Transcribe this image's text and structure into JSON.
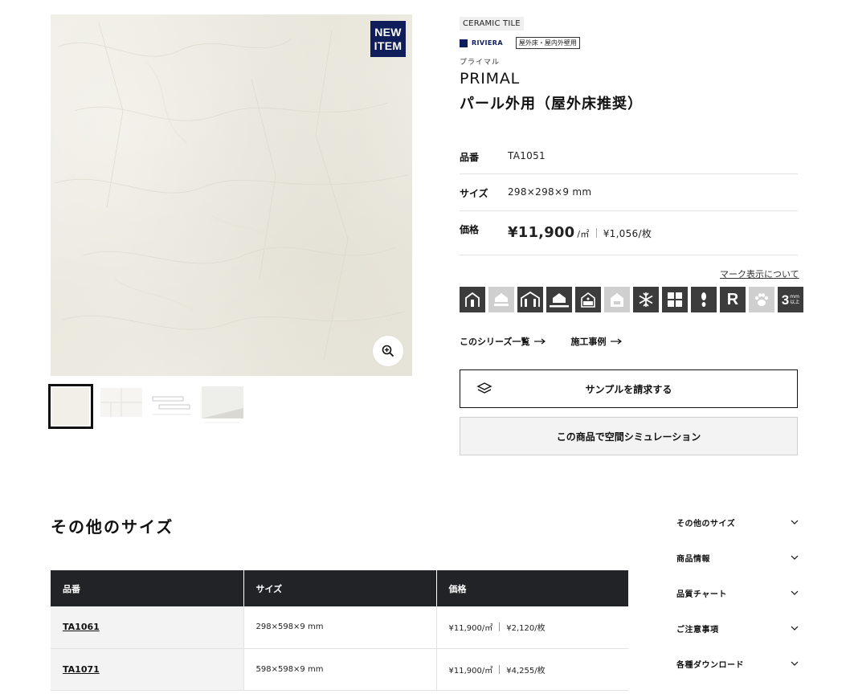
{
  "product": {
    "badge_line1": "NEW",
    "badge_line2": "ITEM",
    "category": "CERAMIC TILE",
    "brand": "RIVIERA",
    "brand_color": "#0f1d5a",
    "usage": "屋外床・屋内外壁用",
    "name_kana": "プライマル",
    "name_en": "PRIMAL",
    "name_jp": "パール外用（屋外床推奨）"
  },
  "specs": {
    "code_label": "品番",
    "code_value": "TA1051",
    "size_label": "サイズ",
    "size_value": "298×298×9 mm",
    "price_label": "価格",
    "price_main": "¥11,900",
    "price_unit": "/㎡",
    "price_sub": "¥1,056/枚"
  },
  "marks": {
    "link": "マーク表示について",
    "icons": [
      "house-outdoor-icon",
      "house-indoor-floor-icon",
      "house-exterior-wall-icon",
      "house-floor-icon",
      "bath-icon",
      "kitchen-icon",
      "snowflake-icon",
      "tile-grid-icon",
      "foot-icon",
      "R",
      "paw-icon",
      "3mm-icon"
    ],
    "r_label": "R",
    "thick_num": "3",
    "thick_unit_top": "mm",
    "thick_unit_bottom": "以上"
  },
  "links": {
    "series": "このシリーズ一覧",
    "examples": "施工事例"
  },
  "buttons": {
    "sample": "サンプルを請求する",
    "simulation": "この商品で空間シミュレーション"
  },
  "other_sizes": {
    "title": "その他のサイズ",
    "headers": [
      "品番",
      "サイズ",
      "価格"
    ],
    "rows": [
      {
        "code": "TA1061",
        "size": "298×598×9 mm",
        "price": "¥11,900/㎡",
        "price_sub": "¥2,120/枚"
      },
      {
        "code": "TA1071",
        "size": "598×598×9 mm",
        "price": "¥11,900/㎡",
        "price_sub": "¥4,255/枚"
      }
    ]
  },
  "side_nav": [
    "その他のサイズ",
    "商品情報",
    "品質チャート",
    "ご注意事項",
    "各種ダウンロード"
  ]
}
